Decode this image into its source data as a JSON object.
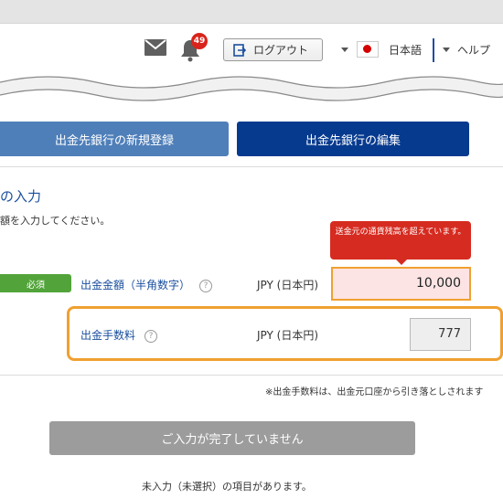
{
  "header": {
    "notification_count": "49",
    "logout_label": "ログアウト",
    "language_label": "日本語",
    "help_label": "ヘルプ"
  },
  "bank_buttons": {
    "register_label": "出金先銀行の新規登録",
    "edit_label": "出金先銀行の編集"
  },
  "form": {
    "section_title": "の入力",
    "section_subtitle": "額を入力してください。",
    "error_tooltip": "送金元の通貨残高を超えています。",
    "required_badge": "必須",
    "amount_label": "出金金額（半角数字）",
    "amount_currency": "JPY (日本円)",
    "amount_value": "10,000",
    "fee_label": "出金手数料",
    "fee_currency": "JPY (日本円)",
    "fee_value": "777",
    "help_glyph": "?",
    "fee_note": "※出金手数料は、出金元口座から引き落としされます",
    "submit_label": "ご入力が完了していません",
    "bottom_note": "未入力（未選択）の項目があります。"
  },
  "colors": {
    "primary_blue": "#063a8f",
    "light_blue": "#4f7fb9",
    "error_red": "#d62b20",
    "required_green": "#52a43a",
    "highlight_orange": "#f0a030"
  }
}
